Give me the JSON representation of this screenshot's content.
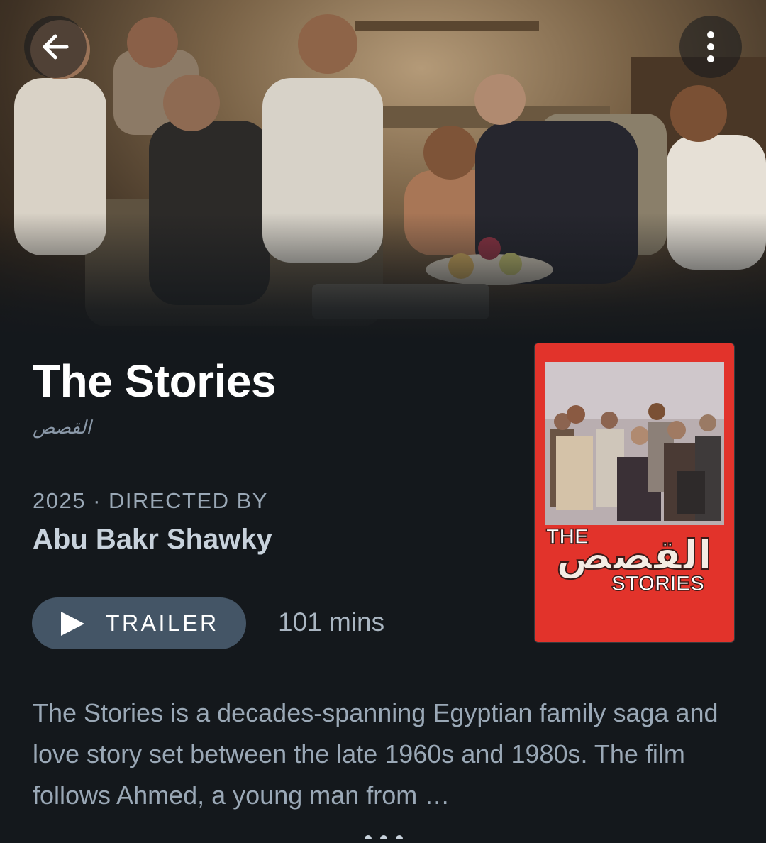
{
  "film": {
    "title": "The Stories",
    "original_title": "القصص",
    "year": "2025",
    "separator": "·",
    "directed_by_label": "DIRECTED BY",
    "director": "Abu Bakr Shawky",
    "runtime": "101 mins",
    "synopsis": "The Stories is a decades-spanning Egyptian family saga and love story set between the late 1960s and 1980s. The film follows Ahmed, a young man from …"
  },
  "actions": {
    "trailer_label": "TRAILER"
  },
  "poster": {
    "title_en_top": "THE",
    "title_ar": "القصص",
    "title_en_bottom": "STORIES"
  },
  "icons": {
    "back": "arrow-left-icon",
    "more": "more-vertical-icon",
    "play": "play-icon",
    "expand": "more-horizontal-icon"
  },
  "colors": {
    "background": "#14181c",
    "button": "#445566",
    "poster_red": "#e2332b"
  }
}
